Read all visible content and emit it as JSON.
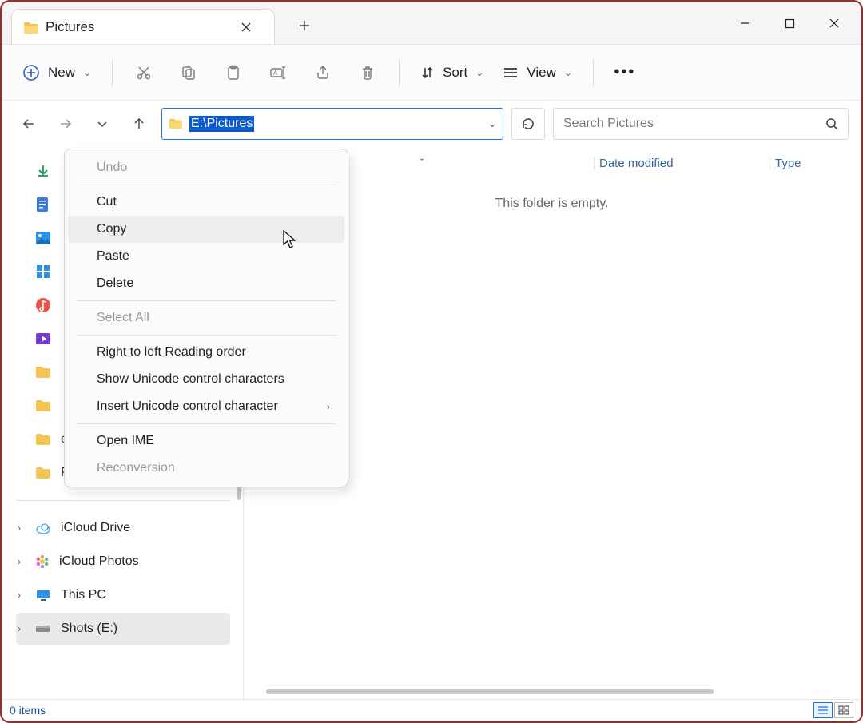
{
  "tab": {
    "title": "Pictures"
  },
  "toolbar": {
    "new": "New",
    "sort": "Sort",
    "view": "View"
  },
  "address": {
    "path": "E:\\Pictures"
  },
  "search": {
    "placeholder": "Search Pictures"
  },
  "columns": {
    "name_sort_hint": "ˇ",
    "date": "Date modified",
    "type": "Type"
  },
  "content": {
    "empty": "This folder is empty."
  },
  "sidebar": {
    "items": [
      {
        "kind": "dl"
      },
      {
        "kind": "doc"
      },
      {
        "kind": "pic"
      },
      {
        "kind": "app"
      },
      {
        "kind": "music"
      },
      {
        "kind": "video"
      },
      {
        "kind": "folder"
      },
      {
        "kind": "folder"
      },
      {
        "kind": "folder",
        "label": "efs"
      },
      {
        "kind": "folder",
        "label": "PING"
      }
    ],
    "drives": [
      {
        "label": "iCloud Drive",
        "kind": "icloud"
      },
      {
        "label": "iCloud Photos",
        "kind": "iphotos"
      },
      {
        "label": "This PC",
        "kind": "pc"
      },
      {
        "label": "Shots (E:)",
        "kind": "disk",
        "selected": true
      }
    ]
  },
  "context_menu": {
    "undo": "Undo",
    "cut": "Cut",
    "copy": "Copy",
    "paste": "Paste",
    "delete": "Delete",
    "select_all": "Select All",
    "rtl": "Right to left Reading order",
    "show_unicode": "Show Unicode control characters",
    "insert_unicode": "Insert Unicode control character",
    "open_ime": "Open IME",
    "reconversion": "Reconversion"
  },
  "status": {
    "count": "0 items"
  }
}
